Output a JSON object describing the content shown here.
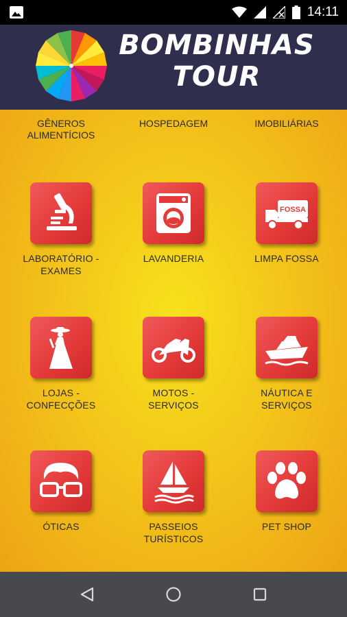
{
  "status_bar": {
    "time": "14:11",
    "icons": [
      "image-icon",
      "wifi-icon",
      "signal-icon",
      "signal-empty-icon",
      "battery-icon"
    ]
  },
  "header": {
    "brand_line1": "BOMBINHAS",
    "brand_line2": "TOUR",
    "bg_color": "#2f2f4d"
  },
  "top_row": [
    {
      "line1": "GÊNEROS",
      "line2": "ALIMENTÍCIOS"
    },
    {
      "line1": "HOSPEDAGEM",
      "line2": ""
    },
    {
      "line1": "IMOBILIÁRIAS",
      "line2": ""
    }
  ],
  "categories": [
    {
      "line1": "LABORATÓRIO -",
      "line2": "EXAMES",
      "icon": "microscope-icon"
    },
    {
      "line1": "LAVANDERIA",
      "line2": "",
      "icon": "washing-machine-icon"
    },
    {
      "line1": "LIMPA FOSSA",
      "line2": "",
      "icon": "septic-truck-icon",
      "icon_text": "FOSSA"
    },
    {
      "line1": "LOJAS -",
      "line2": "CONFECÇÕES",
      "icon": "dress-icon"
    },
    {
      "line1": "MOTOS -",
      "line2": "SERVIÇOS",
      "icon": "motorcycle-icon"
    },
    {
      "line1": "NÁUTICA E",
      "line2": "SERVIÇOS",
      "icon": "yacht-icon"
    },
    {
      "line1": "ÓTICAS",
      "line2": "",
      "icon": "glasses-icon"
    },
    {
      "line1": "PASSEIOS",
      "line2": "TURÍSTICOS",
      "icon": "sailboat-icon"
    },
    {
      "line1": "PET SHOP",
      "line2": "",
      "icon": "paw-icon"
    }
  ],
  "colors": {
    "tile_red": "#e43a3a",
    "background_yellow": "#f6e21c",
    "background_orange": "#eca414",
    "nav_bar": "#48494c"
  },
  "nav_bar": {
    "buttons": [
      "back-icon",
      "home-icon",
      "recents-icon"
    ]
  }
}
